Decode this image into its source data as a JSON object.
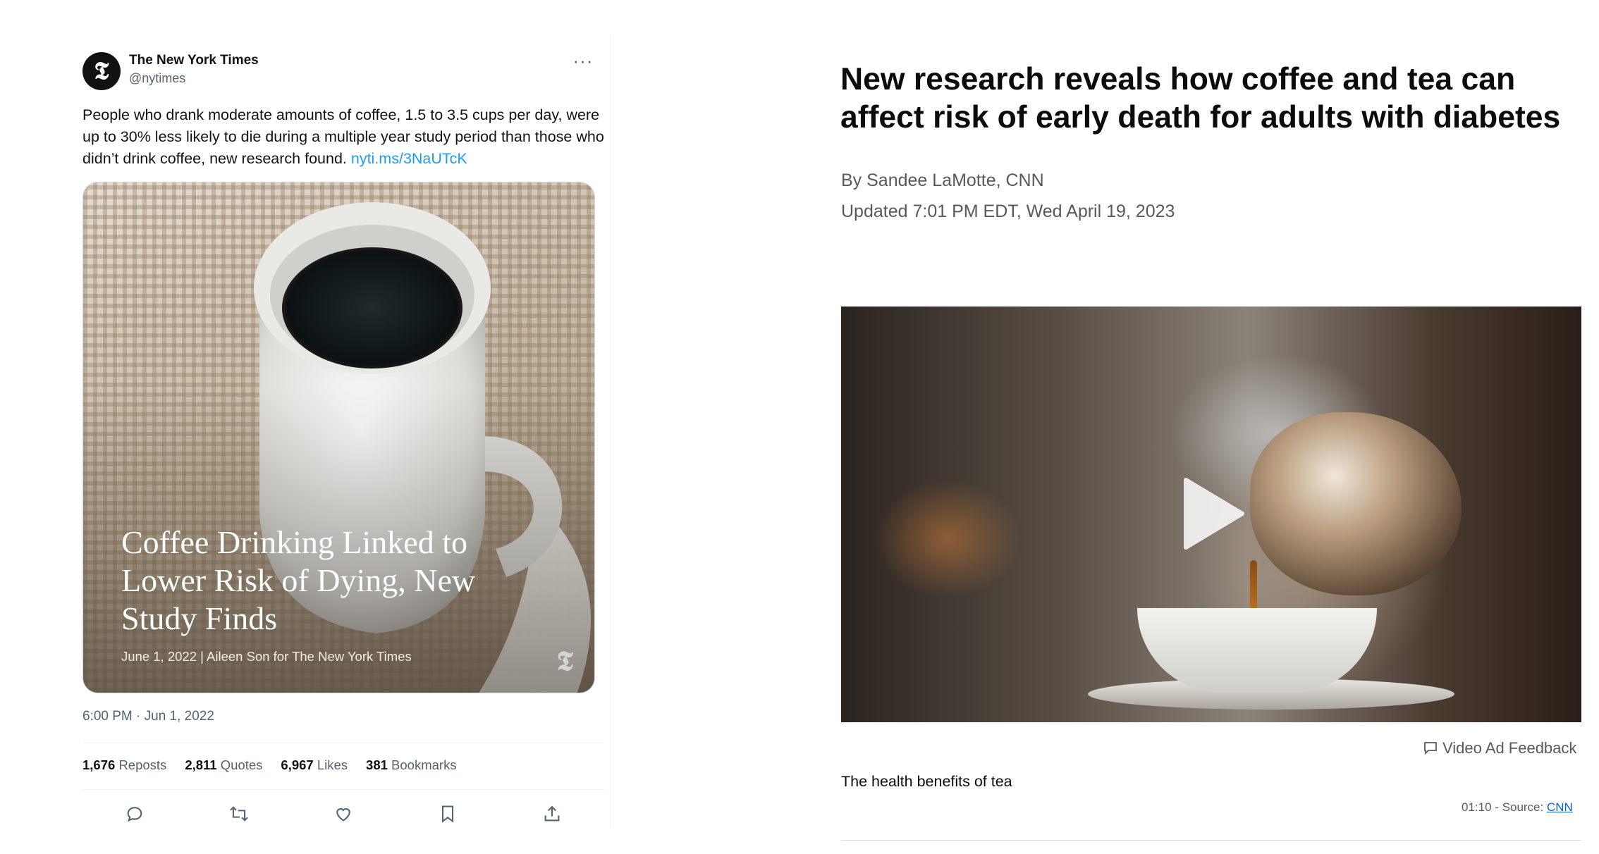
{
  "tweet": {
    "author_name": "The New York Times",
    "author_handle": "@nytimes",
    "avatar_glyph": "𝕿",
    "more_icon": "···",
    "text": "People who drank moderate amounts of coffee, 1.5 to 3.5 cups per day, were up to 30% less likely to die during a multiple year study period than those who didn’t drink coffee, new research found.",
    "link": "nyti.ms/3NaUTcK",
    "media": {
      "headline": "Coffee Drinking Linked to Lower Risk of Dying, New Study Finds",
      "credit": "June 1, 2022 | Aileen Son for The New York Times",
      "watermark": "𝕿"
    },
    "timestamp": "6:00 PM · Jun 1, 2022",
    "stats": {
      "reposts_count": "1,676",
      "reposts_label": "Reposts",
      "quotes_count": "2,811",
      "quotes_label": "Quotes",
      "likes_count": "6,967",
      "likes_label": "Likes",
      "bookmarks_count": "381",
      "bookmarks_label": "Bookmarks"
    },
    "actions": [
      "reply-icon",
      "retweet-icon",
      "like-icon",
      "bookmark-icon",
      "share-icon"
    ]
  },
  "article": {
    "title": "New research reveals how coffee and tea can affect risk of early death for adults with diabetes",
    "byline": "By Sandee LaMotte, CNN",
    "updated": "Updated 7:01 PM EDT, Wed April 19, 2023",
    "video_feedback": "Video Ad Feedback",
    "caption": "The health benefits of tea",
    "source_prefix": "01:10 - Source: ",
    "source_link": "CNN"
  },
  "colors": {
    "link_blue": "#1d9bf0",
    "secondary_gray": "#536471",
    "cnn_link": "#0c62c6"
  }
}
